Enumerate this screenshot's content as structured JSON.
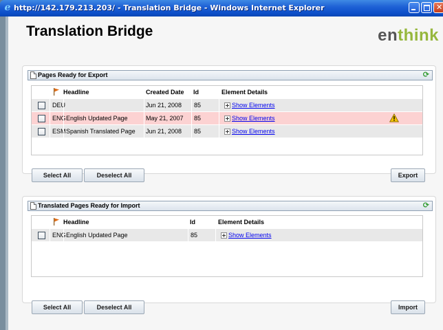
{
  "window": {
    "title": "http://142.179.213.203/ - Translation Bridge - Windows Internet Explorer"
  },
  "app": {
    "title": "Translation Bridge",
    "brand_prefix": "en",
    "brand_accent": "think"
  },
  "export_panel": {
    "title": "Pages Ready for Export",
    "columns": {
      "headline": "Headline",
      "created": "Created Date",
      "id": "Id",
      "details": "Element Details"
    },
    "rows": [
      {
        "lang": "DEU",
        "headline": "",
        "created": "Jun 21, 2008",
        "id": "85",
        "details": "Show Elements",
        "warning": false
      },
      {
        "lang": "ENG",
        "headline": "English Updated Page",
        "created": "May 21, 2007",
        "id": "85",
        "details": "Show Elements",
        "warning": true
      },
      {
        "lang": "ESM",
        "headline": "Spanish Translated Page",
        "created": "Jun 21, 2008",
        "id": "85",
        "details": "Show Elements",
        "warning": false
      }
    ],
    "buttons": {
      "select_all": "Select All",
      "deselect_all": "Deselect All",
      "action": "Export"
    }
  },
  "import_panel": {
    "title": "Translated Pages Ready for Import",
    "columns": {
      "headline": "Headline",
      "id": "Id",
      "details": "Element Details"
    },
    "rows": [
      {
        "lang": "ENG",
        "headline": "English Updated Page",
        "id": "85",
        "details": "Show Elements"
      }
    ],
    "buttons": {
      "select_all": "Select All",
      "deselect_all": "Deselect All",
      "action": "Import"
    }
  },
  "colors": {
    "titlebar": "#1f62d6",
    "alert_row": "#fcd2d2",
    "row": "#e8e8e8",
    "link": "#0000ee",
    "brand_accent": "#96b73d"
  }
}
